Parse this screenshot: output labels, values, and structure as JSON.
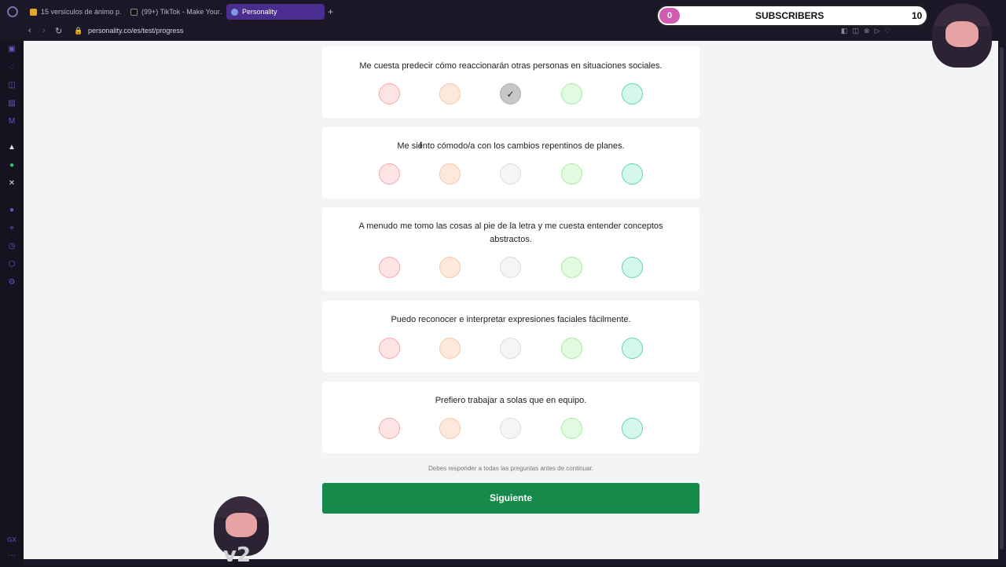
{
  "browser": {
    "tabs": [
      {
        "label": "15 versículos de ánimo p…"
      },
      {
        "label": "(99+) TikTok - Make Your…"
      },
      {
        "label": "Personality"
      }
    ],
    "new_tab": "+",
    "url": "personality.co/es/test/progress"
  },
  "questions": [
    {
      "text": "Me cuesta predecir cómo reaccionarán otras personas en situaciones sociales.",
      "selected": 3
    },
    {
      "text": "Me siento cómodo/a con los cambios repentinos de planes.",
      "selected": null
    },
    {
      "text": "A menudo me tomo las cosas al pie de la letra y me cuesta entender conceptos abstractos.",
      "selected": null
    },
    {
      "text": "Puedo reconocer e interpretar expresiones faciales fácilmente.",
      "selected": null
    },
    {
      "text": "Prefiero trabajar a solas que en equipo.",
      "selected": null
    }
  ],
  "notice": "Debes responder a todas las preguntas antes de continuar.",
  "next_label": "Siguiente",
  "check_glyph": "✓",
  "overlay": {
    "subs_current": "0",
    "subs_label": "SUBSCRIBERS",
    "subs_goal": "10",
    "badge": "v2"
  },
  "colors": {
    "accent": "#168a4a",
    "tab_active": "#4b2d8f"
  }
}
